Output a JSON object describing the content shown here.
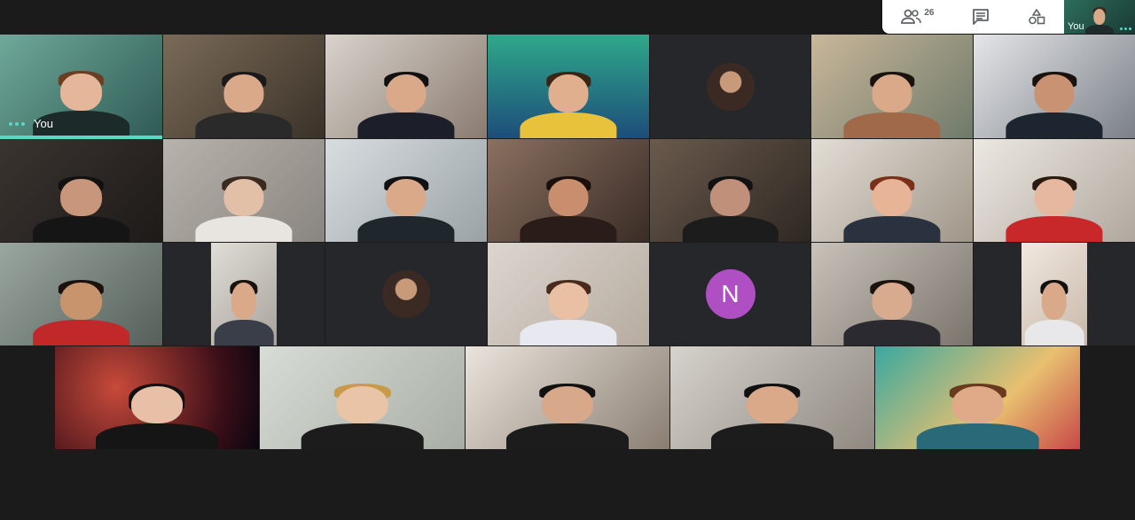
{
  "toolbar": {
    "participants_count": "26",
    "participants_icon": "people-icon",
    "chat_icon": "chat-icon",
    "activities_icon": "activities-icon"
  },
  "self_view": {
    "label": "You"
  },
  "grid": {
    "self_tile_label": "You",
    "initial_avatar": "N",
    "avatar_color": "#b04fc3",
    "active_speaker_color": "#5ad8c3"
  }
}
